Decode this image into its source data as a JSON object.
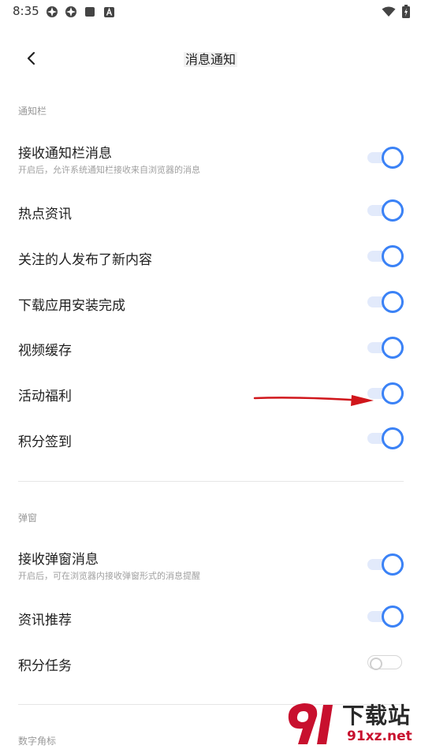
{
  "status_bar": {
    "time": "8:35",
    "icons": [
      "app-icon",
      "app-icon",
      "stop-square-icon",
      "a-badge-icon"
    ],
    "right_icons": [
      "wifi-icon",
      "battery-charging-icon"
    ]
  },
  "header": {
    "title": "消息通知",
    "back_icon": "chevron-left-icon"
  },
  "sections": [
    {
      "label": "通知栏",
      "items": [
        {
          "title": "接收通知栏消息",
          "subtitle": "开启后，允许系统通知栏接收来自浏览器的消息",
          "enabled": true
        },
        {
          "title": "热点资讯",
          "enabled": true
        },
        {
          "title": "关注的人发布了新内容",
          "enabled": true
        },
        {
          "title": "下载应用安装完成",
          "enabled": true
        },
        {
          "title": "视频缓存",
          "enabled": true
        },
        {
          "title": "活动福利",
          "enabled": true
        },
        {
          "title": "积分签到",
          "enabled": true
        }
      ]
    },
    {
      "label": "弹窗",
      "items": [
        {
          "title": "接收弹窗消息",
          "subtitle": "开启后，可在浏览器内接收弹窗形式的消息提醒",
          "enabled": true
        },
        {
          "title": "资讯推荐",
          "enabled": true
        },
        {
          "title": "积分任务",
          "enabled": false
        }
      ]
    },
    {
      "label": "数字角标",
      "items": []
    }
  ],
  "annotation": {
    "arrow_color": "#d0161b",
    "points_to": "活动福利"
  },
  "watermark": {
    "line1": "下载站",
    "line2": "91xz.net",
    "logo_color": "#c8102e"
  },
  "colors": {
    "accent": "#3b82f6",
    "track_on": "#e2eafb"
  }
}
